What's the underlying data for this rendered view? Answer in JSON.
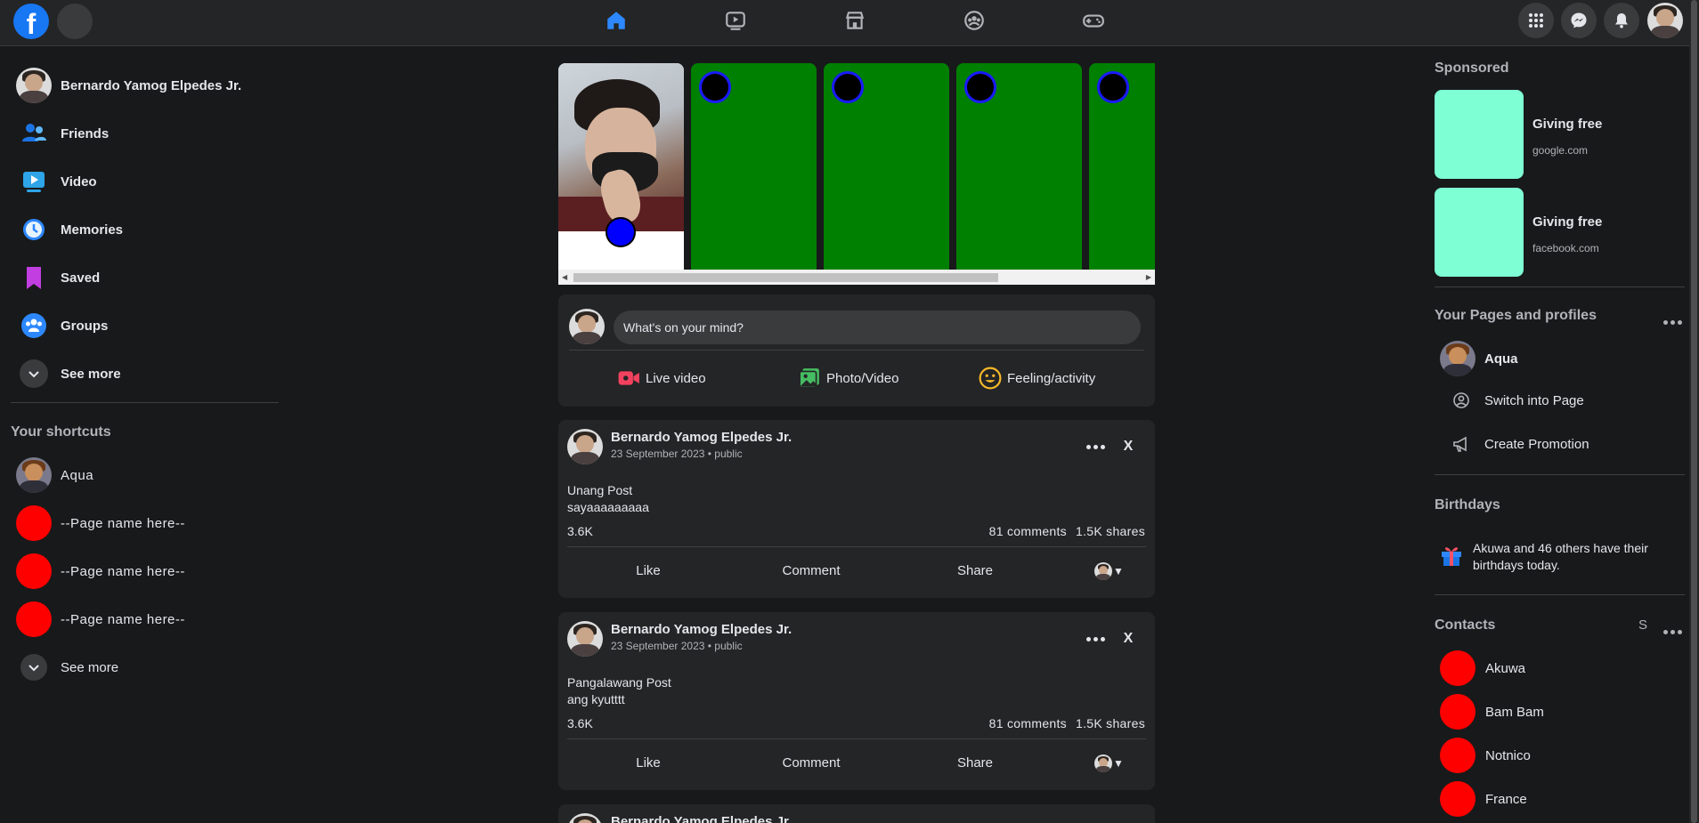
{
  "profile": {
    "name": "Bernardo Yamog Elpedes Jr."
  },
  "left_nav": {
    "items": [
      {
        "label": "Friends",
        "icon": "friends-icon"
      },
      {
        "label": "Video",
        "icon": "video-icon"
      },
      {
        "label": "Memories",
        "icon": "memories-icon"
      },
      {
        "label": "Saved",
        "icon": "saved-icon"
      },
      {
        "label": "Groups",
        "icon": "groups-icon"
      }
    ],
    "see_more": "See more"
  },
  "shortcuts": {
    "title": "Your shortcuts",
    "items": [
      {
        "label": "Aqua"
      },
      {
        "label": "--Page name here--"
      },
      {
        "label": "--Page name here--"
      },
      {
        "label": "--Page name here--"
      }
    ],
    "see_more": "See more"
  },
  "composer": {
    "placeholder": "What's on your mind?",
    "actions": [
      "Live video",
      "Photo/Video",
      "Feeling/activity"
    ]
  },
  "posts": [
    {
      "author": "Bernardo Yamog Elpedes Jr.",
      "meta": "23 September 2023 • public",
      "line1": "Unang Post",
      "line2": "sayaaaaaaaaa",
      "reactions": "3.6K",
      "comments": "81 comments",
      "shares": "1.5K shares",
      "actions": [
        "Like",
        "Comment",
        "Share"
      ],
      "close": "X"
    },
    {
      "author": "Bernardo Yamog Elpedes Jr.",
      "meta": "23 September 2023 • public",
      "line1": "Pangalawang Post",
      "line2": "ang kyutttt",
      "reactions": "3.6K",
      "comments": "81 comments",
      "shares": "1.5K shares",
      "actions": [
        "Like",
        "Comment",
        "Share"
      ],
      "close": "X"
    },
    {
      "author": "Bernardo Yamog Elpedes Jr."
    }
  ],
  "sponsored": {
    "title": "Sponsored",
    "items": [
      {
        "title": "Giving free",
        "url": "google.com",
        "color": "#7fffd4"
      },
      {
        "title": "Giving free",
        "url": "facebook.com",
        "color": "#7fffd4"
      }
    ]
  },
  "pages": {
    "title": "Your Pages and profiles",
    "page_name": "Aqua",
    "switch": "Switch into Page",
    "promote": "Create Promotion"
  },
  "birthdays": {
    "title": "Birthdays",
    "text": "Akuwa and 46 others have their birthdays today."
  },
  "contacts": {
    "title": "Contacts",
    "search_letter": "S",
    "items": [
      "Akuwa",
      "Bam Bam",
      "Notnico",
      "France"
    ]
  },
  "colors": {
    "background": "#18191a",
    "surface": "#242526",
    "accent": "#1877f2",
    "story_green": "#008000",
    "placeholder_red": "#ff0000"
  }
}
